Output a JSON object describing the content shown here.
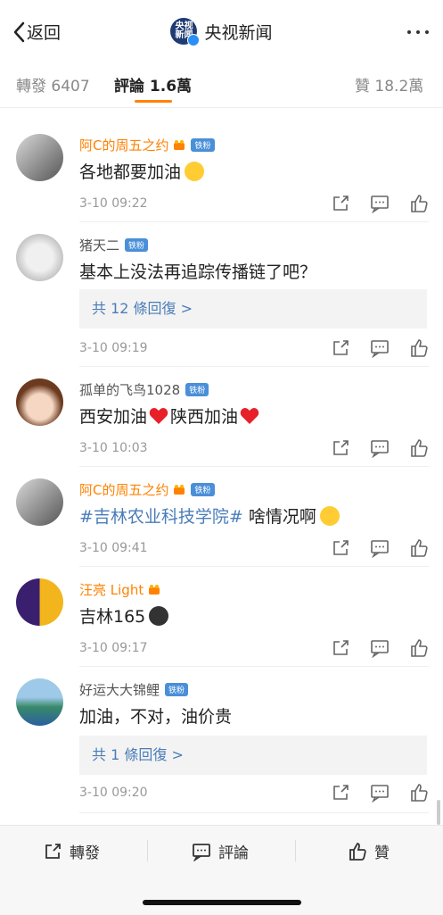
{
  "nav": {
    "back_label": "返回",
    "title": "央视新闻",
    "logo_text": "央视\n新闻"
  },
  "tabs": {
    "repost": "轉發 6407",
    "comment": "評論 1.6萬",
    "like": "贊 18.2萬"
  },
  "comments": [
    {
      "user": "阿C的周五之约",
      "badge": "铁粉",
      "text": "各地都要加油",
      "time": "3-10 09:22"
    },
    {
      "user": "猪天二",
      "badge": "铁粉",
      "text": "基本上没法再追踪传播链了吧？",
      "reply": "共 12 條回復 >",
      "time": "3-10 09:19"
    },
    {
      "user": "孤单的飞鸟1028",
      "badge": "铁粉",
      "text1": "西安加油",
      "text2": "陕西加油",
      "time": "3-10 10:03"
    },
    {
      "user": "阿C的周五之约",
      "badge": "铁粉",
      "tag": "#吉林农业科技学院#",
      "text": " 啥情况啊",
      "time": "3-10 09:41"
    },
    {
      "user": "汪亮 Light",
      "text": "吉林165",
      "time": "3-10 09:17"
    },
    {
      "user": "好运大大锦鲤",
      "badge": "铁粉",
      "text": "加油，不对，油价贵",
      "reply": "共 1 條回復 >",
      "time": "3-10 09:20"
    }
  ],
  "bottom": {
    "repost": "轉發",
    "comment": "評論",
    "like": "贊"
  }
}
